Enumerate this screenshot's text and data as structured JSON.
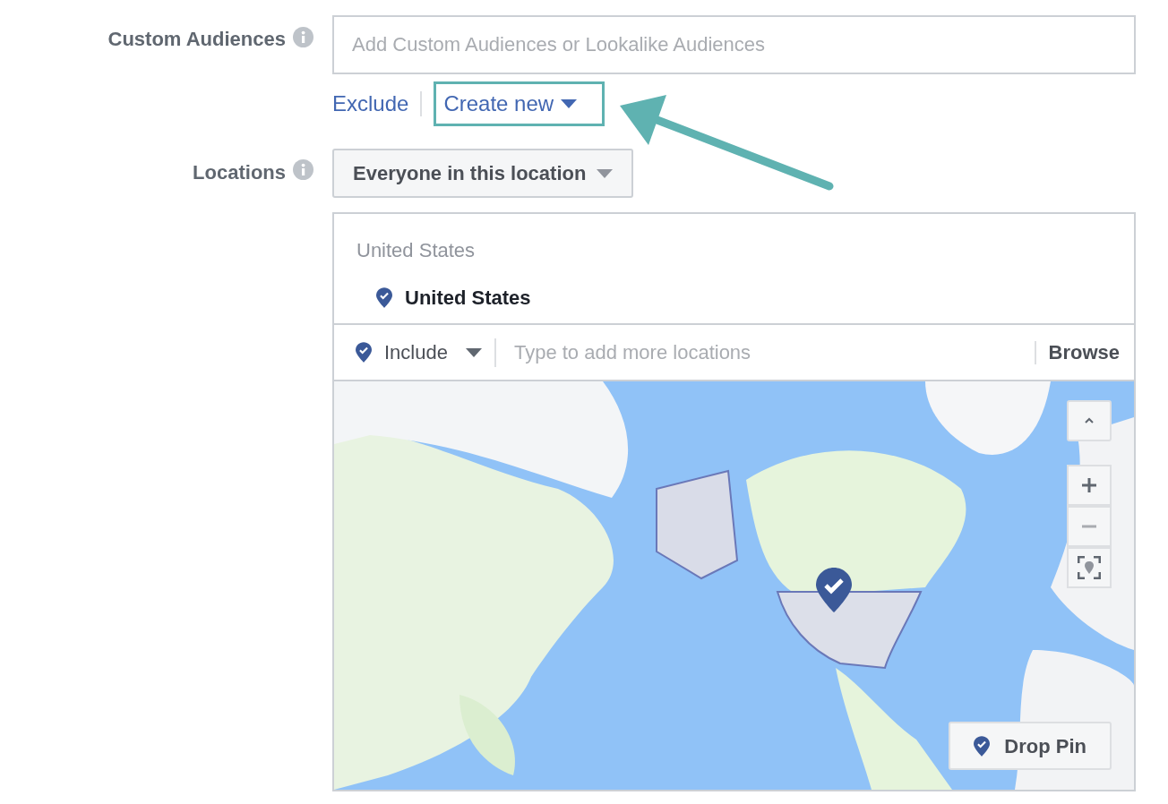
{
  "custom_audiences": {
    "label": "Custom Audiences",
    "placeholder": "Add Custom Audiences or Lookalike Audiences",
    "links": [
      {
        "label": "Exclude",
        "highlighted": false,
        "dropdown": false
      },
      {
        "label": "Create new",
        "highlighted": true,
        "dropdown": true
      }
    ]
  },
  "locations": {
    "label": "Locations",
    "dropdown": "Everyone in this location",
    "header": "United States",
    "selected": [
      {
        "label": "United States"
      }
    ],
    "mode": "Include",
    "placeholder": "Type to add more locations",
    "browse": "Browse"
  },
  "map": {
    "kind": "picture",
    "controls": [
      {
        "kind": "collapse"
      },
      {
        "kind": "zoom-in"
      },
      {
        "kind": "zoom-out"
      },
      {
        "kind": "recenter"
      }
    ],
    "drop_pin": "Drop Pin"
  }
}
